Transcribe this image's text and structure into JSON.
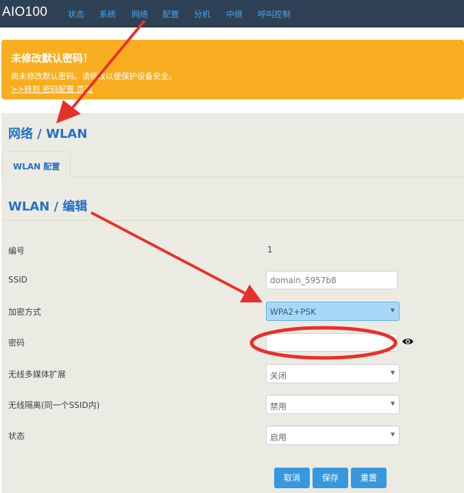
{
  "brand": "AIO100",
  "nav": [
    "状态",
    "系统",
    "网络",
    "配置",
    "分机",
    "中继",
    "呼叫控制"
  ],
  "alert": {
    "title": "未修改默认密码！",
    "text": "尚未修改默认密码。请修改以便保护设备安全。",
    "link": ">>转到 密码配置 页面"
  },
  "page_title": "网络 / WLAN",
  "tab": "WLAN 配置",
  "section_title": "WLAN / 编辑",
  "form": {
    "id_label": "编号",
    "id_value": "1",
    "ssid_label": "SSID",
    "ssid_value": "domain_5957b8",
    "encryption_label": "加密方式",
    "encryption_value": "WPA2+PSK",
    "password_label": "密码",
    "password_value": "",
    "wmm_label": "无线多媒体扩展",
    "wmm_value": "关闭",
    "isolation_label": "无线隔离(同一个SSID内)",
    "isolation_value": "禁用",
    "status_label": "状态",
    "status_value": "启用"
  },
  "buttons": {
    "cancel": "取消",
    "save": "保存",
    "reset": "重置"
  },
  "colors": {
    "navbar": "#2f4154",
    "alert": "#f8ae20",
    "accent": "#2470c6",
    "button": "#3798de",
    "annotation": "#e8302b"
  }
}
